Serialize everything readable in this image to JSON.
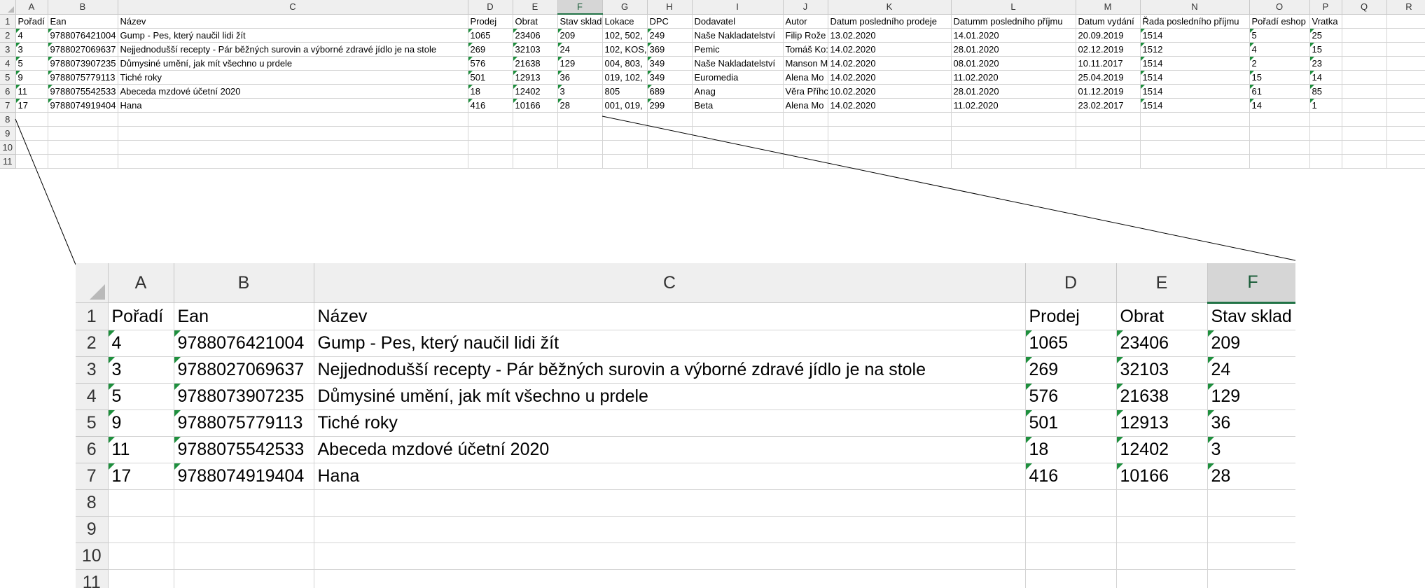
{
  "spreadsheet": {
    "columns": [
      "A",
      "B",
      "C",
      "D",
      "E",
      "F",
      "G",
      "H",
      "I",
      "J",
      "K",
      "L",
      "M",
      "N",
      "O",
      "P",
      "Q",
      "R"
    ],
    "active_column": "F",
    "row_numbers": [
      "1",
      "2",
      "3",
      "4",
      "5",
      "6",
      "7",
      "8",
      "9",
      "10",
      "11"
    ],
    "headers": [
      "Pořadí",
      "Ean",
      "Název",
      "Prodej",
      "Obrat",
      "Stav sklad",
      "Lokace",
      "DPC",
      "Dodavatel",
      "Autor",
      "Datum posledního prodeje",
      "Datumm posledního příjmu",
      "Datum vydání",
      "Řada posledního příjmu",
      "Pořadí eshop",
      "Vratka",
      "",
      ""
    ],
    "rows": [
      [
        "4",
        "9788076421004",
        "Gump - Pes, který naučil lidi žít",
        "1065",
        "23406",
        "209",
        "102, 502,",
        "249",
        "Naše Nakladatelství",
        "Filip Rože",
        "13.02.2020",
        "14.01.2020",
        "20.09.2019",
        "1514",
        "5",
        "25",
        "",
        ""
      ],
      [
        "3",
        "9788027069637",
        "Nejjednodušší recepty - Pár běžných surovin a výborné zdravé jídlo je na stole",
        "269",
        "32103",
        "24",
        "102, KOS,",
        "369",
        "Pemic",
        "Tomáš Ko:",
        "14.02.2020",
        "28.01.2020",
        "02.12.2019",
        "1512",
        "4",
        "15",
        "",
        ""
      ],
      [
        "5",
        "9788073907235",
        "Důmysiné umění, jak mít všechno u prdele",
        "576",
        "21638",
        "129",
        "004, 803,",
        "349",
        "Naše Nakladatelství",
        "Manson M",
        "14.02.2020",
        "08.01.2020",
        "10.11.2017",
        "1514",
        "2",
        "23",
        "",
        ""
      ],
      [
        "9",
        "9788075779113",
        "Tiché roky",
        "501",
        "12913",
        "36",
        "019, 102,",
        "349",
        "Euromedia",
        "Alena Mo",
        "14.02.2020",
        "11.02.2020",
        "25.04.2019",
        "1514",
        "15",
        "14",
        "",
        ""
      ],
      [
        "11",
        "9788075542533",
        "Abeceda mzdové účetní 2020",
        "18",
        "12402",
        "3",
        "805",
        "689",
        "Anag",
        "Věra Příhc",
        "10.02.2020",
        "28.01.2020",
        "01.12.2019",
        "1514",
        "61",
        "85",
        "",
        ""
      ],
      [
        "17",
        "9788074919404",
        "Hana",
        "416",
        "10166",
        "28",
        "001, 019,",
        "299",
        "Beta",
        "Alena Mo",
        "14.02.2020",
        "11.02.2020",
        "23.02.2017",
        "1514",
        "14",
        "1",
        "",
        ""
      ]
    ],
    "green_triangle_color": "#1e8f3d",
    "active_header_color": "#217346"
  }
}
